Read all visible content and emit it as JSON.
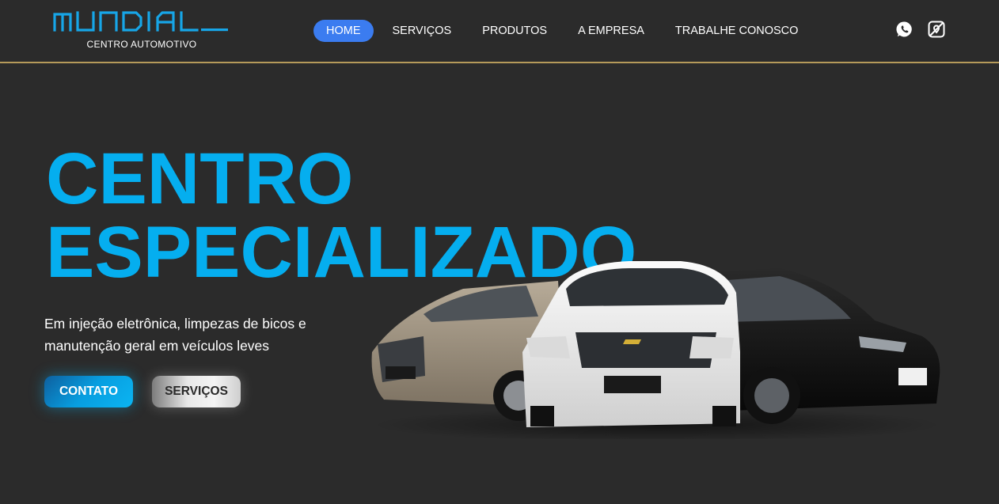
{
  "brand": {
    "name": "MUNDIAL",
    "subtitle": "CENTRO AUTOMOTIVO"
  },
  "nav": {
    "items": [
      {
        "label": "HOME",
        "active": true
      },
      {
        "label": "SERVIÇOS",
        "active": false
      },
      {
        "label": "PRODUTOS",
        "active": false
      },
      {
        "label": "A EMPRESA",
        "active": false
      },
      {
        "label": "TRABALHE CONOSCO",
        "active": false
      }
    ]
  },
  "social": {
    "icons": [
      "whatsapp-icon",
      "location-icon"
    ]
  },
  "hero": {
    "title_line1": "CENTRO",
    "title_line2": "ESPECIALIZADO",
    "description": "Em injeção eletrônica, limpezas de bicos e manutenção geral em veículos leves",
    "contact_button": "CONTATO",
    "services_button": "SERVIÇOS"
  },
  "colors": {
    "background": "#2b2b2b",
    "accent": "#05aeef",
    "nav_active": "#3b7cf0",
    "header_border": "#b59a5a"
  }
}
